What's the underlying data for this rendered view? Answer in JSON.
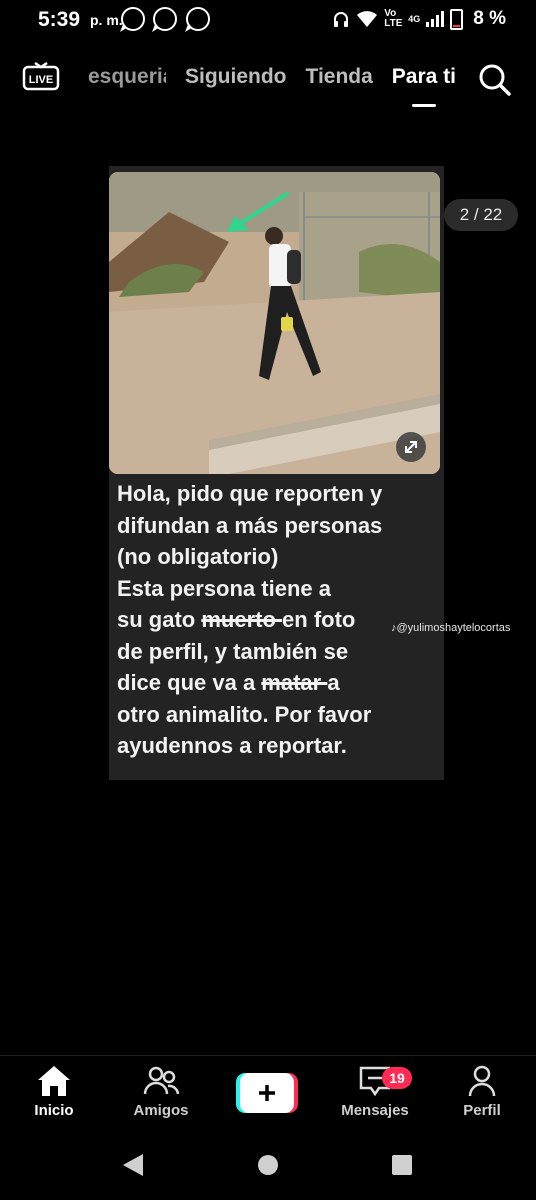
{
  "status_bar": {
    "time": "5:39",
    "ampm": "p. m.",
    "battery": "8 %",
    "network_label": "Vo LTE",
    "network_gen": "4G"
  },
  "top_nav": {
    "tabs": [
      "esqueria",
      "Siguiendo",
      "Tienda",
      "Para ti"
    ],
    "active_tab": "Para ti",
    "live_label": "LIVE"
  },
  "post": {
    "counter": "2 / 22",
    "watermark": "@yulimoshaytelocortas",
    "caption_lines": [
      "Hola, pido que reporten y",
      "difundan a más personas",
      "(no obligatorio)",
      "Esta persona tiene a"
    ],
    "line5_a": "su gato ",
    "line5_strike": "muerto ",
    "line5_b": "en foto",
    "line6": "de perfil, y también se",
    "line7_a": "dice que va a ",
    "line7_strike": "matar ",
    "line7_b": "a",
    "line8": "otro animalito. Por favor",
    "line9": "ayudennos a reportar."
  },
  "bottom_nav": {
    "home": "Inicio",
    "friends": "Amigos",
    "messages": "Mensajes",
    "messages_badge": "19",
    "profile": "Perfil"
  },
  "colors": {
    "background": "#000000",
    "badge": "#ff2b55",
    "create_left": "#25f4ee",
    "create_right": "#fe2c55"
  }
}
